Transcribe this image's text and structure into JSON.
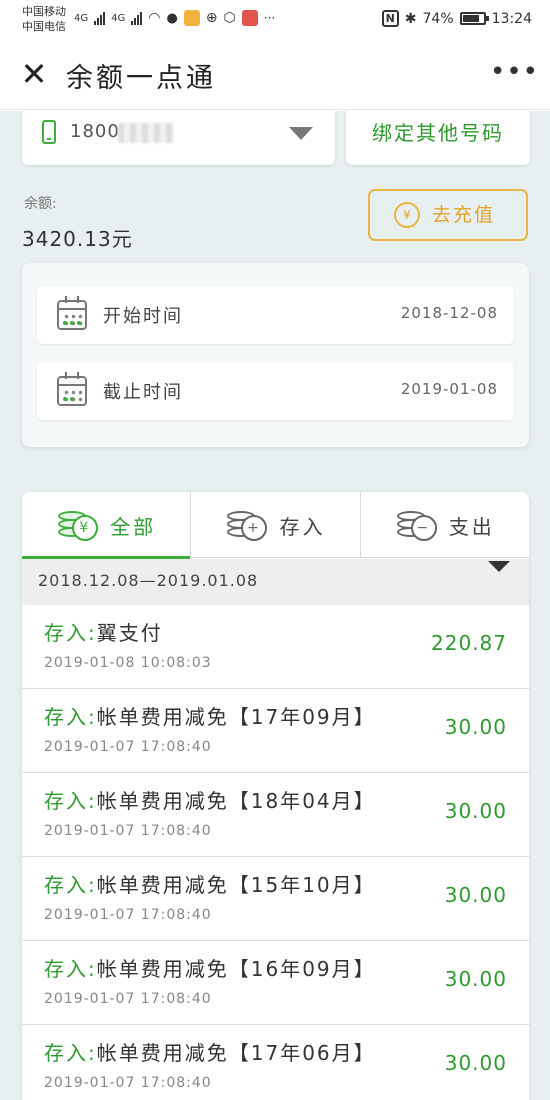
{
  "status_bar": {
    "carrier1": "中国移动",
    "carrier2": "中国电信",
    "net1": "4G",
    "net2": "4G",
    "nfc": "N",
    "battery": "74%",
    "time": "13:24"
  },
  "header": {
    "close_glyph": "✕",
    "title": "余额一点通",
    "more_glyph": "•••"
  },
  "account": {
    "phone_number": "1800",
    "bind_other_label": "绑定其他号码",
    "balance_label": "余额:",
    "balance_value": "3420.13元",
    "recharge_label": "去充值",
    "recharge_icon_glyph": "¥"
  },
  "date_filter": {
    "start_label": "开始时间",
    "start_value": "2018-12-08",
    "end_label": "截止时间",
    "end_value": "2019-01-08"
  },
  "tabs": [
    {
      "label": "全部",
      "icon": "coins-yuan-icon",
      "glyph": "¥",
      "active": true
    },
    {
      "label": "存入",
      "icon": "coins-plus-icon",
      "glyph": "+",
      "active": false
    },
    {
      "label": "支出",
      "icon": "coins-minus-icon",
      "glyph": "−",
      "active": false
    }
  ],
  "range_text": "2018.12.08—2019.01.08",
  "transactions": [
    {
      "type": "存入:",
      "desc": "翼支付",
      "time": "2019-01-08 10:08:03",
      "amount": "220.87"
    },
    {
      "type": "存入:",
      "desc": "帐单费用减免【17年09月】",
      "time": "2019-01-07 17:08:40",
      "amount": "30.00"
    },
    {
      "type": "存入:",
      "desc": "帐单费用减免【18年04月】",
      "time": "2019-01-07 17:08:40",
      "amount": "30.00"
    },
    {
      "type": "存入:",
      "desc": "帐单费用减免【15年10月】",
      "time": "2019-01-07 17:08:40",
      "amount": "30.00"
    },
    {
      "type": "存入:",
      "desc": "帐单费用减免【16年09月】",
      "time": "2019-01-07 17:08:40",
      "amount": "30.00"
    },
    {
      "type": "存入:",
      "desc": "帐单费用减免【17年06月】",
      "time": "2019-01-07 17:08:40",
      "amount": "30.00"
    }
  ],
  "colors": {
    "accent_green": "#2e9b2e",
    "recharge_gold": "#e0a520",
    "page_bg": "#e8eff0"
  }
}
